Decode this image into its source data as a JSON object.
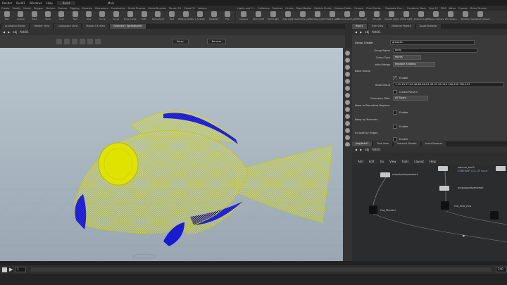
{
  "menubar": {
    "items": [
      "Render",
      "Build1",
      "Windows",
      "Help"
    ],
    "desktop": "Build",
    "center_label": "Main"
  },
  "shelf_left": {
    "tabs": [
      "Create",
      "Modify",
      "Model",
      "Polygon",
      "Deform",
      "Texture",
      "Rigging",
      "Muscles",
      "Characters",
      "Constraints",
      "Guide Process",
      "Guide Brushes",
      "Terrain FX",
      "Cloud FX",
      "Volume"
    ],
    "tools": [
      "Box",
      "Sphere",
      "Tube",
      "Torus",
      "Grid",
      "Null",
      "Line",
      "Circle",
      "Curve",
      "Draw Curve",
      "Path",
      "Spray Paint",
      "Text",
      "Platonic Solids",
      "L-System",
      "Metaball",
      "File"
    ]
  },
  "shelf_right": {
    "tabs": [
      "Lights and C...",
      "Collisions",
      "Particles",
      "Grains",
      "Rigid Bodies",
      "Particle Fluids",
      "Viscous Fluids",
      "Oceans",
      "Fluid Conta...",
      "Populate Con...",
      "Container Tools",
      "Pyro FX",
      "FEM",
      "Wires",
      "Crowds",
      "Drive Simula..."
    ],
    "tools": [
      "Camera",
      "Point Light",
      "Spot Light",
      "Area Light",
      "Geometry Light",
      "Volume Light",
      "Distant Light",
      "Environment Light",
      "Sky Light",
      "GI Light",
      "Caustic Light",
      "Portal Light",
      "Ambient Light",
      "Stereo Camera",
      "VR Camera",
      "Switcher",
      "Gamepad Camera"
    ]
  },
  "viewport": {
    "tabs": [
      "Animation Editor",
      "Render View",
      "Composite View",
      "Motion FX View",
      "Geometry Spreadsheet"
    ],
    "path": [
      "obj",
      "fish01"
    ],
    "view_dropdown": "Persp",
    "cam_dropdown": "No cam",
    "overlay": "",
    "colors": {
      "mesh": "#e4e600",
      "selected": "#1a1ad0",
      "bg_top": "#b9c6cf",
      "bg_bottom": "#9aa7b2"
    }
  },
  "params": {
    "tabs": [
      "fish01",
      "Tree View",
      "Material Palette",
      "Asset Browser"
    ],
    "path": [
      "obj",
      "fish01"
    ],
    "node_type": "Group Create",
    "node_name": "group11",
    "group_name_label": "Group Name",
    "group_name": "body",
    "group_type_label": "Group Type",
    "group_type": "Points",
    "initial_merge_label": "Initial Merge",
    "initial_merge": "Replace Existing",
    "base_group_section": "Base Group",
    "enable_label": "Enable",
    "base_group_label": "Base Group",
    "base_group_value": "1-31 33 37-43 46-84 86-91 93 97 99-114 116-130 132-137",
    "create_pattern_label": "Create Pattern",
    "geometry_filter_label": "Geometry Filter",
    "geometry_filter": "All Types",
    "keep_bounding_section": "Keep in Bounding Regions",
    "enable2_label": "Enable",
    "keep_normals_section": "Keep by Normals",
    "enable3_label": "Enable",
    "include_edges_section": "Include by Edges",
    "enable4_label": "Enable"
  },
  "network": {
    "tabs": [
      "/obj/fish01",
      "Tree View",
      "Material Palette",
      "Asset Browser"
    ],
    "path": [
      "obj",
      "fish01"
    ],
    "menu": [
      "Add",
      "Edit",
      "Go",
      "View",
      "Tools",
      "Layout",
      "Help"
    ],
    "nodes": [
      {
        "label": "outputpointpreview4",
        "badge": "S"
      },
      {
        "label": "Out_MouthU",
        "badge": "S"
      },
      {
        "label": "volume_test3",
        "badge": "S"
      },
      {
        "label": "outputpointpreview3",
        "badge": "S"
      },
      {
        "label": "Out_Side_Fins",
        "badge": "S"
      },
      {
        "label": "CUBEMAP_CLS_OF Input",
        "badge": ""
      }
    ]
  },
  "timeline": {
    "frame": "1",
    "end": "240"
  }
}
